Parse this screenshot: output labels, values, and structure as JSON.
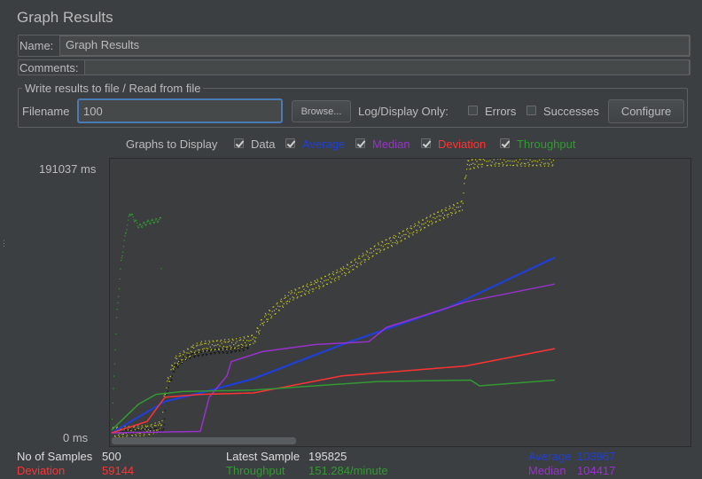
{
  "panel": {
    "title": "Graph Results"
  },
  "name_field": {
    "label": "Name:",
    "value": "Graph Results"
  },
  "comments_field": {
    "label": "Comments:",
    "value": ""
  },
  "file_group": {
    "legend": "Write results to file / Read from file",
    "filename_label": "Filename",
    "filename_value": "100",
    "browse_label": "Browse...",
    "log_display_label": "Log/Display Only:",
    "errors_label": "Errors",
    "errors_checked": false,
    "successes_label": "Successes",
    "successes_checked": false,
    "configure_label": "Configure"
  },
  "graphs_to_display": {
    "label": "Graphs to Display",
    "options": [
      {
        "label": "Data",
        "checked": true,
        "color": "#bbbbbb"
      },
      {
        "label": "Average",
        "checked": true,
        "color": "#1f3fd6"
      },
      {
        "label": "Median",
        "checked": true,
        "color": "#9932cc"
      },
      {
        "label": "Deviation",
        "checked": true,
        "color": "#ff3333"
      },
      {
        "label": "Throughput",
        "checked": true,
        "color": "#339933"
      }
    ]
  },
  "chart_data": {
    "type": "scatter",
    "y_max_label": "191037  ms",
    "y_min_label": "0  ms",
    "ylim": [
      0,
      191037
    ],
    "xlim": [
      0,
      500
    ],
    "series": [
      {
        "name": "Data",
        "color": "#c8c820",
        "kind": "scatter",
        "points": [
          [
            0,
            1000
          ],
          [
            20,
            1500
          ],
          [
            40,
            2000
          ],
          [
            55,
            5000
          ],
          [
            60,
            30000
          ],
          [
            70,
            50000
          ],
          [
            90,
            58000
          ],
          [
            100,
            61000
          ],
          [
            140,
            63000
          ],
          [
            160,
            66000
          ],
          [
            170,
            79000
          ],
          [
            200,
            96000
          ],
          [
            230,
            104000
          ],
          [
            260,
            113000
          ],
          [
            300,
            130000
          ],
          [
            320,
            136000
          ],
          [
            360,
            150000
          ],
          [
            395,
            160000
          ],
          [
            400,
            188000
          ],
          [
            420,
            191000
          ],
          [
            450,
            191037
          ],
          [
            500,
            191037
          ]
        ]
      },
      {
        "name": "Average",
        "color": "#1f3fd6",
        "kind": "line",
        "points": [
          [
            0,
            0
          ],
          [
            60,
            22000
          ],
          [
            100,
            28000
          ],
          [
            160,
            38000
          ],
          [
            260,
            62000
          ],
          [
            380,
            88000
          ],
          [
            500,
            123000
          ]
        ]
      },
      {
        "name": "Median",
        "color": "#9932cc",
        "kind": "line",
        "points": [
          [
            0,
            0
          ],
          [
            100,
            1000
          ],
          [
            110,
            25000
          ],
          [
            130,
            40000
          ],
          [
            135,
            50000
          ],
          [
            170,
            57000
          ],
          [
            230,
            62000
          ],
          [
            290,
            64000
          ],
          [
            310,
            74000
          ],
          [
            400,
            92000
          ],
          [
            500,
            104417
          ]
        ]
      },
      {
        "name": "Deviation",
        "color": "#ff3333",
        "kind": "line",
        "points": [
          [
            0,
            0
          ],
          [
            40,
            8000
          ],
          [
            60,
            25000
          ],
          [
            100,
            27000
          ],
          [
            160,
            28000
          ],
          [
            260,
            40000
          ],
          [
            400,
            47000
          ],
          [
            500,
            59144
          ]
        ]
      },
      {
        "name": "Throughput",
        "color": "#339933",
        "kind": "line",
        "points": [
          [
            0,
            2000
          ],
          [
            30,
            20000
          ],
          [
            50,
            27000
          ],
          [
            80,
            29000
          ],
          [
            160,
            30000
          ],
          [
            300,
            36000
          ],
          [
            405,
            37000
          ],
          [
            415,
            33000
          ],
          [
            500,
            37000
          ]
        ]
      }
    ],
    "throughput_early": {
      "color": "#339933",
      "points": [
        [
          0,
          10000
        ],
        [
          5,
          80000
        ],
        [
          10,
          120000
        ],
        [
          15,
          140000
        ],
        [
          20,
          155000
        ],
        [
          25,
          150000
        ],
        [
          30,
          145000
        ],
        [
          40,
          148000
        ],
        [
          55,
          150000
        ],
        [
          56,
          80000
        ]
      ]
    },
    "data_early_dots": {
      "color": "#111111",
      "points": [
        [
          10,
          1000
        ],
        [
          30,
          1500
        ],
        [
          50,
          2000
        ],
        [
          58,
          3000
        ],
        [
          62,
          30000
        ],
        [
          70,
          45000
        ],
        [
          80,
          52000
        ],
        [
          90,
          55000
        ],
        [
          100,
          56000
        ],
        [
          110,
          57000
        ],
        [
          120,
          58000
        ],
        [
          130,
          58000
        ],
        [
          140,
          59000
        ],
        [
          150,
          60000
        ],
        [
          155,
          62000
        ]
      ]
    },
    "grid": false
  },
  "stats": {
    "samples_label": "No of Samples",
    "samples_value": "500",
    "latest_label": "Latest Sample",
    "latest_value": "195825",
    "average_label": "Average",
    "average_value": "103967",
    "deviation_label": "Deviation",
    "deviation_value": "59144",
    "throughput_label": "Throughput",
    "throughput_value": "151.284/minute",
    "median_label": "Median",
    "median_value": "104417"
  },
  "colors": {
    "background": "#3c3f41",
    "average": "#1f3fd6",
    "median": "#9932cc",
    "deviation": "#ff3333",
    "throughput": "#339933",
    "data": "#c8c820"
  }
}
